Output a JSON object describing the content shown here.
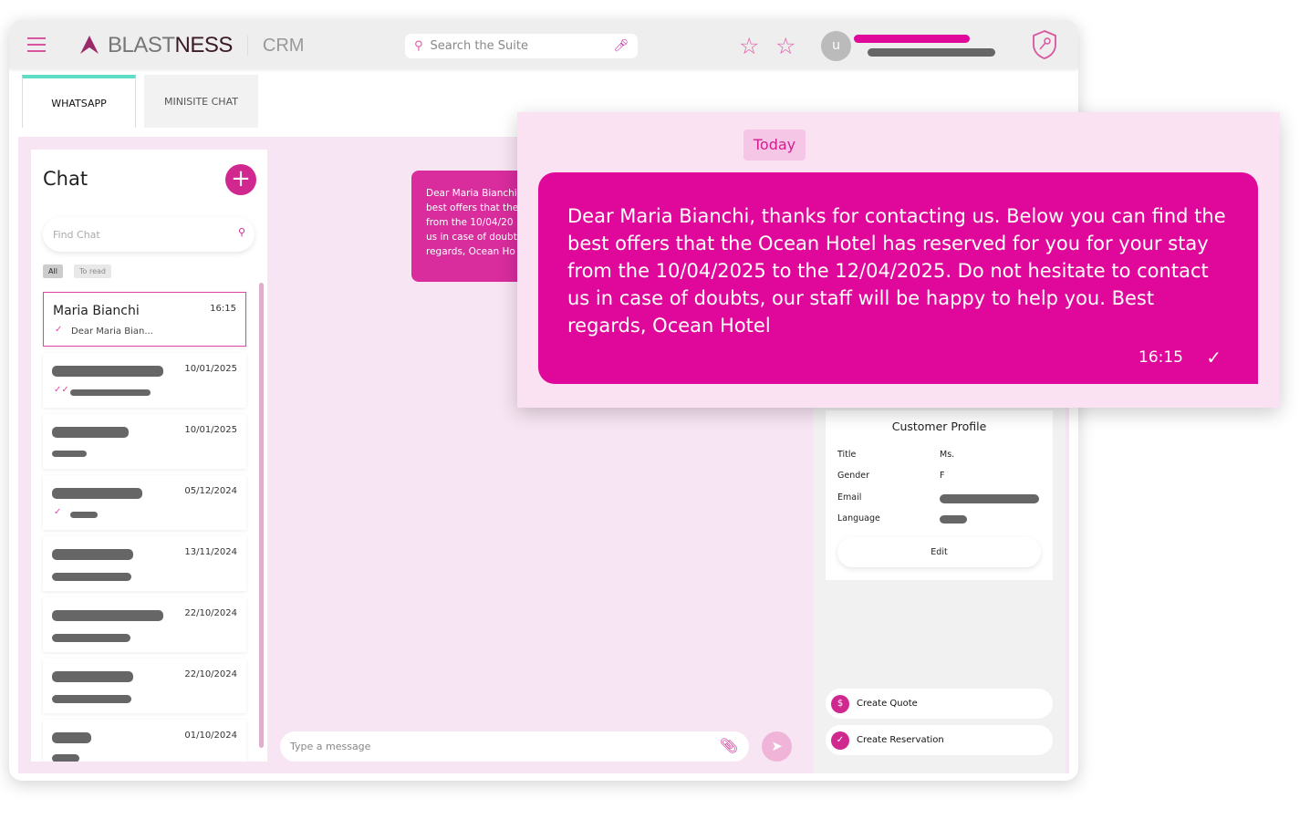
{
  "header": {
    "brand_a": "BLAST",
    "brand_b": "NESS",
    "product": "CRM",
    "search_placeholder": "Search the Suite",
    "avatar_letter": "u"
  },
  "tabs": [
    {
      "label": "WHATSAPP"
    },
    {
      "label": "MINISITE CHAT"
    }
  ],
  "chat_list": {
    "title": "Chat",
    "find_placeholder": "Find Chat",
    "filters": [
      "All",
      "To read"
    ],
    "items": [
      {
        "name": "Maria Bianchi",
        "time": "16:15",
        "preview": "Dear Maria Bian..."
      },
      {
        "time": "10/01/2025"
      },
      {
        "time": "10/01/2025"
      },
      {
        "time": "05/12/2024"
      },
      {
        "time": "13/11/2024"
      },
      {
        "time": "22/10/2024"
      },
      {
        "time": "22/10/2024"
      },
      {
        "time": "01/10/2024"
      }
    ]
  },
  "conversation": {
    "bubble_preview": "Dear Maria Bianchi\nbest offers that the\nfrom the 10/04/20\nus in case of doubt\nregards, Ocean Ho",
    "input_placeholder": "Type a message"
  },
  "popup": {
    "date_label": "Today",
    "message": "Dear Maria Bianchi, thanks for contacting us. Below you can find the best offers that the Ocean Hotel has reserved for you for your stay from the 10/04/2025 to the 12/04/2025. Do not hesitate to contact us in case of doubts, our staff will be happy to help you. Best regards, Ocean Hotel",
    "time": "16:15"
  },
  "profile": {
    "title": "Customer Profile",
    "fields": [
      {
        "label": "Title",
        "value": "Ms."
      },
      {
        "label": "Gender",
        "value": "F"
      },
      {
        "label": "Email"
      },
      {
        "label": "Language"
      }
    ],
    "edit": "Edit"
  },
  "actions": {
    "quote": "Create Quote",
    "reservation": "Create Reservation"
  },
  "colors": {
    "accent": "#e0089a",
    "tab_active": "#5fdcc6",
    "bg_pink": "#f8e5f3"
  }
}
